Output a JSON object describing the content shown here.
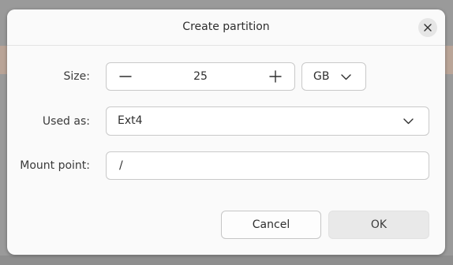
{
  "dialog": {
    "title": "Create partition",
    "close_icon": "close-icon"
  },
  "size": {
    "label": "Size:",
    "value": "25",
    "decrement_icon": "minus-icon",
    "increment_icon": "plus-icon",
    "unit": "GB",
    "unit_icon": "chevron-down-icon"
  },
  "used_as": {
    "label": "Used as:",
    "value": "Ext4",
    "dropdown_icon": "chevron-down-icon"
  },
  "mount_point": {
    "label": "Mount point:",
    "value": "/"
  },
  "buttons": {
    "cancel": "Cancel",
    "ok": "OK"
  },
  "colors": {
    "dialog_bg": "#fafafa",
    "field_border": "#c9c9c9",
    "ok_button_bg": "#e9e9e9",
    "backdrop": "#9a9a9a",
    "backdrop_accent": "#b9a497"
  }
}
